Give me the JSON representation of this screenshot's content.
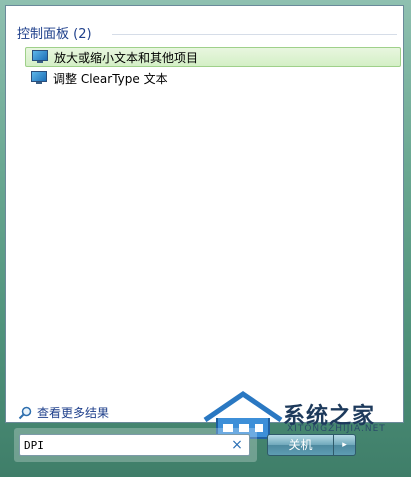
{
  "results_panel": {
    "group_title": "控制面板 (2)",
    "items": [
      {
        "label": "放大或缩小文本和其他项目",
        "icon": "display-control-panel-icon",
        "selected": true
      },
      {
        "label": "调整 ClearType 文本",
        "icon": "display-control-panel-icon",
        "selected": false
      }
    ],
    "see_more": "查看更多结果"
  },
  "search": {
    "value": "DPI",
    "clear_glyph": "×"
  },
  "shutdown": {
    "label": "关机",
    "arrow_glyph": "▸"
  },
  "watermark": {
    "brand": "系统之家",
    "url": "XITONGZHIJIA.NET"
  },
  "colors": {
    "accent_blue": "#1e3f8b",
    "selection_green": "#d4efc6",
    "frame": "#4f927b"
  }
}
